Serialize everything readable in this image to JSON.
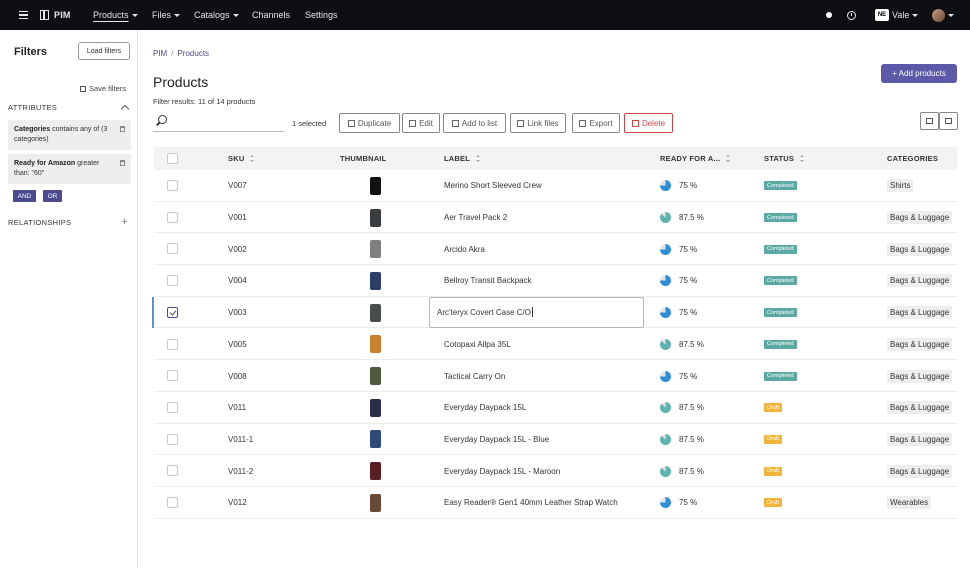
{
  "topbar": {
    "app_name": "PIM",
    "nav": [
      "Products",
      "Files",
      "Catalogs",
      "Channels",
      "Settings"
    ],
    "org_badge": "NE",
    "user": "Vale"
  },
  "sidebar": {
    "title": "Filters",
    "load_filters": "Load filters",
    "save_filters": "Save filters",
    "attributes_heading": "ATTRIBUTES",
    "filters": [
      {
        "name": "Categories",
        "rest": " contains any of (3 categories)"
      },
      {
        "name": "Ready for Amazon",
        "rest": " greater than: \"60\""
      }
    ],
    "and_label": "AND",
    "or_label": "OR",
    "relationships_heading": "RELATIONSHIPS"
  },
  "main": {
    "breadcrumb": [
      "PIM",
      "Products"
    ],
    "title": "Products",
    "filter_results": "Filter results: 11 of 14 products",
    "add_products": "+ Add products",
    "selected_count": "1 selected",
    "actions": [
      "Duplicate",
      "Edit",
      "Add to list",
      "Link files",
      "Export",
      "Delete"
    ],
    "columns": {
      "sku": "SKU",
      "thumbnail": "THUMBNAIL",
      "label": "LABEL",
      "ready": "READY FOR A...",
      "status": "STATUS",
      "categories": "CATEGORIES"
    },
    "rows": [
      {
        "sku": "V007",
        "label": "Merino Short Sleeved Crew",
        "ready": "75 %",
        "status": "Completed",
        "category": "Shirts",
        "checked": false
      },
      {
        "sku": "V001",
        "label": "Aer Travel Pack 2",
        "ready": "87.5 %",
        "status": "Completed",
        "category": "Bags & Luggage",
        "checked": false
      },
      {
        "sku": "V002",
        "label": "Arcido Akra",
        "ready": "75 %",
        "status": "Completed",
        "category": "Bags & Luggage",
        "checked": false
      },
      {
        "sku": "V004",
        "label": "Bellroy Transit Backpack",
        "ready": "75 %",
        "status": "Completed",
        "category": "Bags & Luggage",
        "checked": false
      },
      {
        "sku": "V003",
        "label": "Arc'teryx Covert Case C/O",
        "ready": "75 %",
        "status": "Completed",
        "category": "Bags & Luggage",
        "checked": true
      },
      {
        "sku": "V005",
        "label": "Cotopaxi Allpa 35L",
        "ready": "87.5 %",
        "status": "Completed",
        "category": "Bags & Luggage",
        "checked": false
      },
      {
        "sku": "V008",
        "label": "Tactical Carry On",
        "ready": "75 %",
        "status": "Completed",
        "category": "Bags & Luggage",
        "checked": false
      },
      {
        "sku": "V011",
        "label": "Everyday Daypack 15L",
        "ready": "87.5 %",
        "status": "Draft",
        "category": "Bags & Luggage",
        "checked": false
      },
      {
        "sku": "V011-1",
        "label": "Everyday Daypack 15L - Blue",
        "ready": "87.5 %",
        "status": "Draft",
        "category": "Bags & Luggage",
        "checked": false
      },
      {
        "sku": "V011-2",
        "label": "Everyday Daypack 15L - Maroon",
        "ready": "87.5 %",
        "status": "Draft",
        "category": "Bags & Luggage",
        "checked": false
      },
      {
        "sku": "V012",
        "label": "Easy Reader® Gen1 40mm Leather Strap Watch",
        "ready": "75 %",
        "status": "Draft",
        "category": "Wearables",
        "checked": false
      }
    ],
    "thumb_colors": [
      "#111111",
      "#3a3d40",
      "#7d7f80",
      "#2c3e66",
      "#4a4d4e",
      "#c8832c",
      "#4f5a3e",
      "#2a2f4a",
      "#2d4a7a",
      "#5a1e24",
      "#6b4a35"
    ],
    "status_colors": {
      "Completed": "#5aa9a4",
      "Draft": "#f2b43a"
    },
    "pie_colors": {
      "75 %": "#2f8fd6",
      "87.5 %": "#5fb2ae"
    },
    "accent": "#5c5aa8",
    "delete_color": "#d34545"
  }
}
